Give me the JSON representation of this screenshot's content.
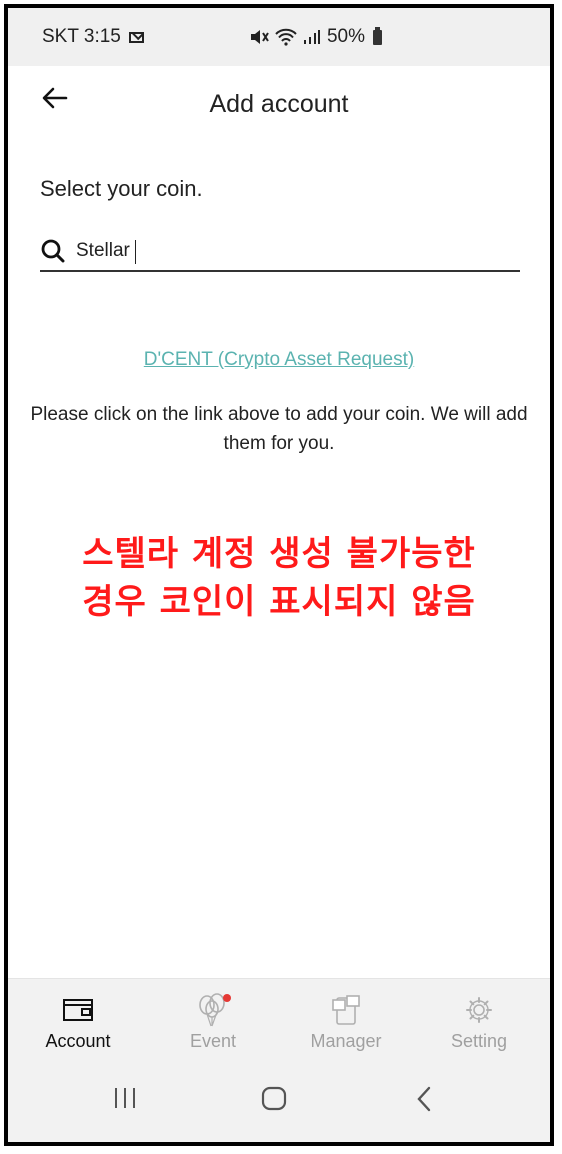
{
  "status_bar": {
    "carrier_time": "SKT 3:15",
    "battery": "50%"
  },
  "header": {
    "title": "Add account",
    "back_icon": "arrow-left-icon"
  },
  "content": {
    "select_label": "Select your coin.",
    "search_value": "Stellar",
    "request_link": "D'CENT (Crypto Asset Request)",
    "info_text": "Please click on the link above to add your coin. We will add them for you.",
    "note_line1": "스텔라 계정 생성 불가능한",
    "note_line2": "경우 코인이 표시되지 않음"
  },
  "bottom_nav": {
    "items": [
      {
        "label": "Account",
        "icon": "wallet-icon",
        "active": true
      },
      {
        "label": "Event",
        "icon": "balloons-icon",
        "active": false
      },
      {
        "label": "Manager",
        "icon": "manager-icon",
        "active": false
      },
      {
        "label": "Setting",
        "icon": "gear-icon",
        "active": false
      }
    ]
  },
  "colors": {
    "link": "#5bb3b0",
    "note": "#ff1a1a",
    "badge": "#e53935"
  }
}
